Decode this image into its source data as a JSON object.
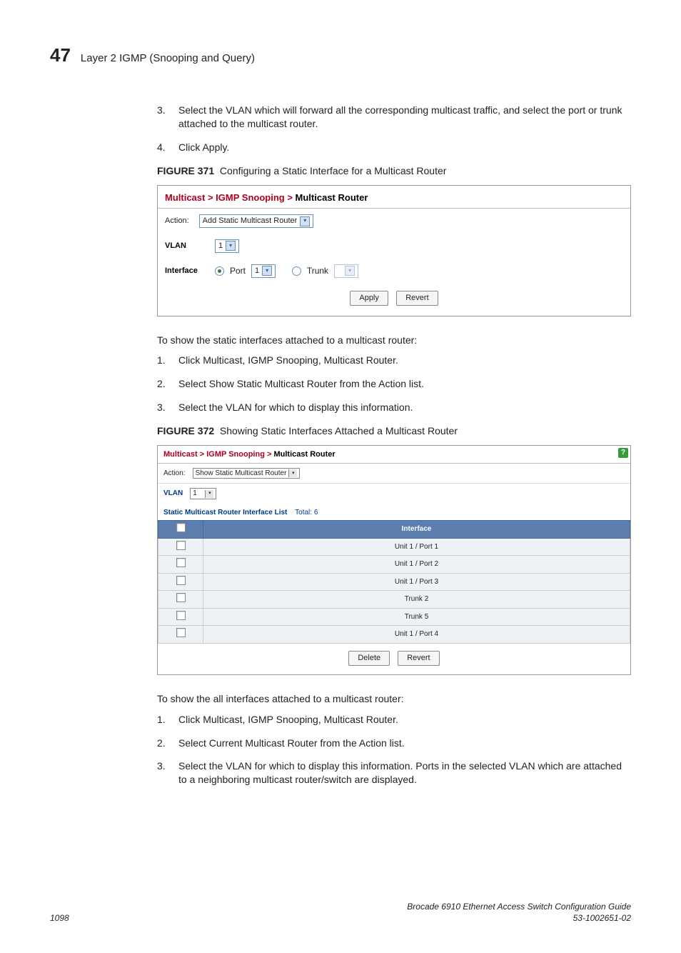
{
  "header": {
    "chapter_number": "47",
    "chapter_title": "Layer 2 IGMP (Snooping and Query)"
  },
  "steps_a": [
    {
      "num": "3.",
      "text": "Select the VLAN which will forward all the corresponding multicast traffic, and select the port or trunk attached to the multicast router."
    },
    {
      "num": "4.",
      "text": "Click Apply."
    }
  ],
  "figure371": {
    "label": "FIGURE 371",
    "caption": "Configuring a Static Interface for a Multicast Router",
    "breadcrumb": {
      "a": "Multicast",
      "b": "IGMP Snooping",
      "c": "Multicast Router"
    },
    "action_label": "Action:",
    "action_value": "Add Static Multicast Router",
    "vlan_label": "VLAN",
    "vlan_value": "1",
    "interface_label": "Interface",
    "port_label": "Port",
    "port_value": "1",
    "trunk_label": "Trunk",
    "apply": "Apply",
    "revert": "Revert"
  },
  "para_b": "To show the static interfaces attached to a multicast router:",
  "steps_b": [
    {
      "num": "1.",
      "text": "Click Multicast, IGMP Snooping, Multicast Router."
    },
    {
      "num": "2.",
      "text": "Select Show Static Multicast Router from the Action list."
    },
    {
      "num": "3.",
      "text": "Select the VLAN for which to display this information."
    }
  ],
  "figure372": {
    "label": "FIGURE 372",
    "caption": "Showing Static Interfaces Attached a Multicast Router",
    "breadcrumb": {
      "a": "Multicast",
      "b": "IGMP Snooping",
      "c": "Multicast Router"
    },
    "action_label": "Action:",
    "action_value": "Show Static Multicast Router",
    "vlan_label": "VLAN",
    "vlan_value": "1",
    "list_title": "Static Multicast Router Interface List",
    "total_label": "Total:",
    "total_value": "6",
    "col_interface": "Interface",
    "rows": [
      "Unit 1 / Port 1",
      "Unit 1 / Port 2",
      "Unit 1 / Port 3",
      "Trunk 2",
      "Trunk 5",
      "Unit 1 / Port 4"
    ],
    "delete": "Delete",
    "revert": "Revert",
    "help": "?"
  },
  "para_c": "To show the all interfaces attached to a multicast router:",
  "steps_c": [
    {
      "num": "1.",
      "text": "Click Multicast, IGMP Snooping, Multicast Router."
    },
    {
      "num": "2.",
      "text": "Select Current Multicast Router from the Action list."
    },
    {
      "num": "3.",
      "text": "Select the VLAN for which to display this information. Ports in the selected VLAN which are attached to a neighboring multicast router/switch are displayed."
    }
  ],
  "footer": {
    "page": "1098",
    "title": "Brocade 6910 Ethernet Access Switch Configuration Guide",
    "docnum": "53-1002651-02"
  }
}
